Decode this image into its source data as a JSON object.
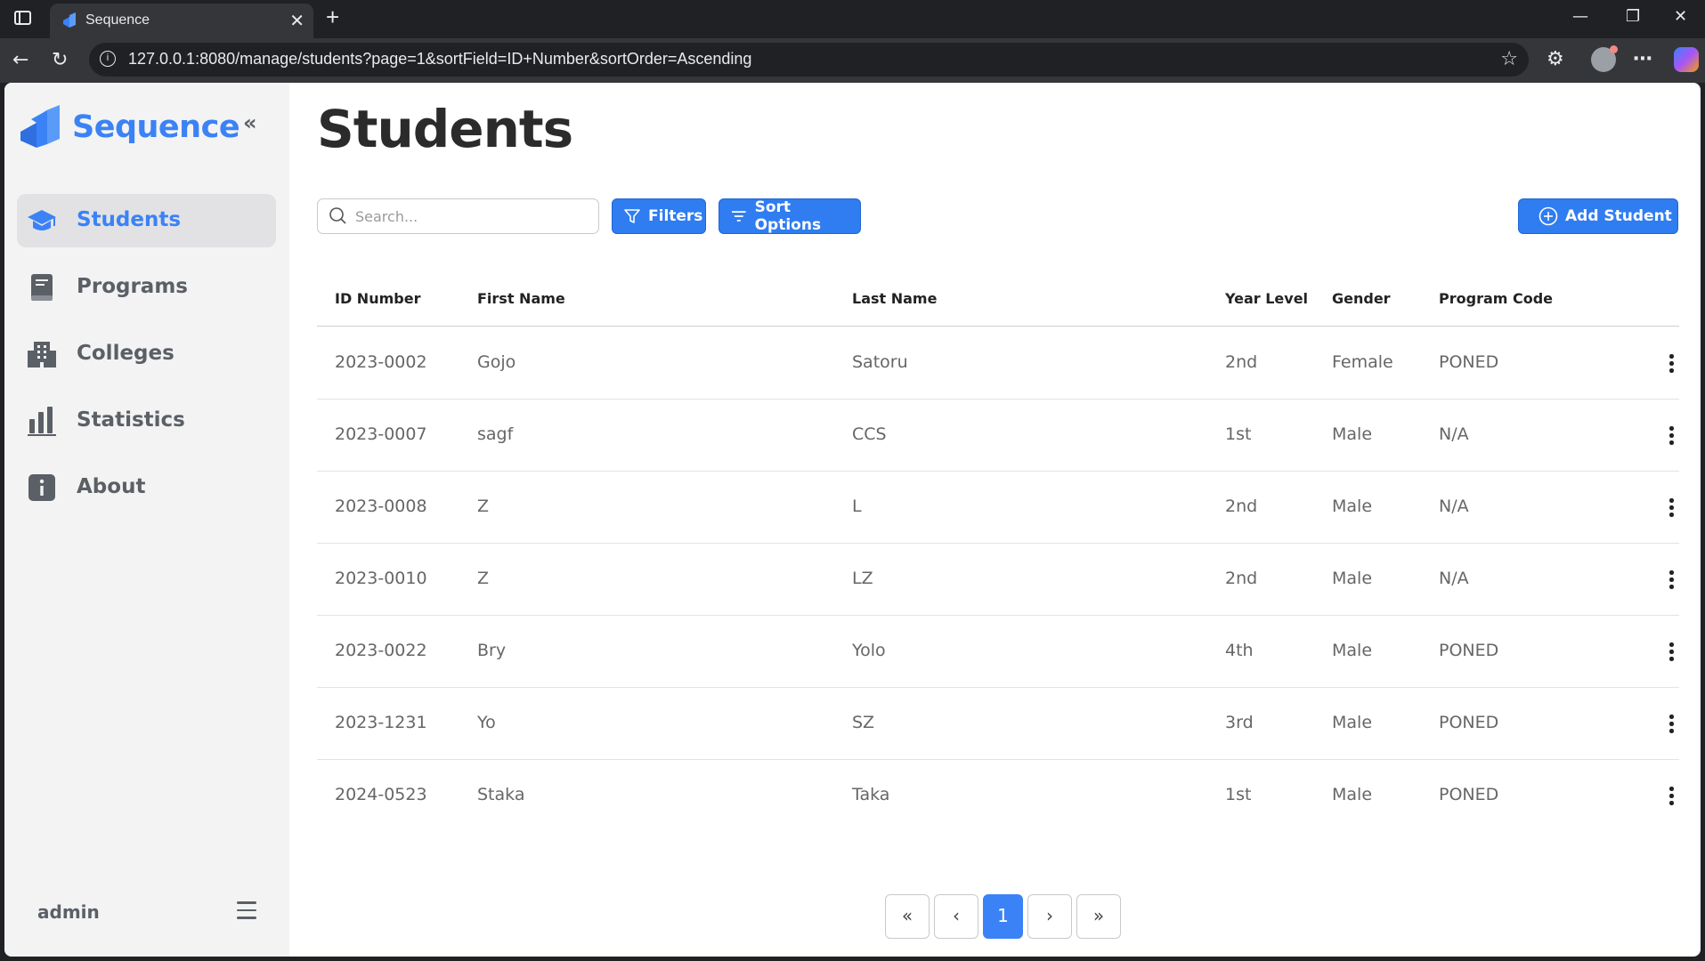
{
  "browser": {
    "tab_title": "Sequence",
    "tab_close": "✕",
    "new_tab": "+",
    "url": "127.0.0.1:8080/manage/students?page=1&sortField=ID+Number&sortOrder=Ascending",
    "info_glyph": "i",
    "icons": [
      "sidebar-toggle-icon",
      "back-icon",
      "reload-icon",
      "info-icon",
      "star-icon",
      "extensions-icon",
      "profile-icon",
      "more-icon",
      "copilot-icon",
      "minimize-icon",
      "restore-icon",
      "close-icon"
    ]
  },
  "sidebar": {
    "brand": "Sequence",
    "collapse_glyph": "«",
    "items": [
      {
        "label": "Students",
        "icon": "graduation-cap-icon",
        "active": true
      },
      {
        "label": "Programs",
        "icon": "book-icon",
        "active": false
      },
      {
        "label": "Colleges",
        "icon": "building-icon",
        "active": false
      },
      {
        "label": "Statistics",
        "icon": "bar-chart-icon",
        "active": false
      },
      {
        "label": "About",
        "icon": "info-icon",
        "active": false
      }
    ],
    "user": "admin"
  },
  "main": {
    "title": "Students",
    "search_placeholder": "Search...",
    "filters_label": "Filters",
    "sort_label": "Sort Options",
    "add_label": "Add Student",
    "columns": [
      "ID Number",
      "First Name",
      "Last Name",
      "Year Level",
      "Gender",
      "Program Code"
    ],
    "rows": [
      [
        "2023-0002",
        "Gojo",
        "Satoru",
        "2nd",
        "Female",
        "PONED"
      ],
      [
        "2023-0007",
        "sagf",
        "CCS",
        "1st",
        "Male",
        "N/A"
      ],
      [
        "2023-0008",
        "Z",
        "L",
        "2nd",
        "Male",
        "N/A"
      ],
      [
        "2023-0010",
        "Z",
        "LZ",
        "2nd",
        "Male",
        "N/A"
      ],
      [
        "2023-0022",
        "Bry",
        "Yolo",
        "4th",
        "Male",
        "PONED"
      ],
      [
        "2023-1231",
        "Yo",
        "SZ",
        "3rd",
        "Male",
        "PONED"
      ],
      [
        "2024-0523",
        "Staka",
        "Taka",
        "1st",
        "Male",
        "PONED"
      ]
    ],
    "pagination": {
      "first": "«",
      "prev": "‹",
      "current": "1",
      "next": "›",
      "last": "»"
    }
  },
  "colors": {
    "accent": "#3b82f6",
    "button": "#2f7df0",
    "sidebar_bg": "#f3f3f3",
    "text_muted": "#5b5f66"
  }
}
